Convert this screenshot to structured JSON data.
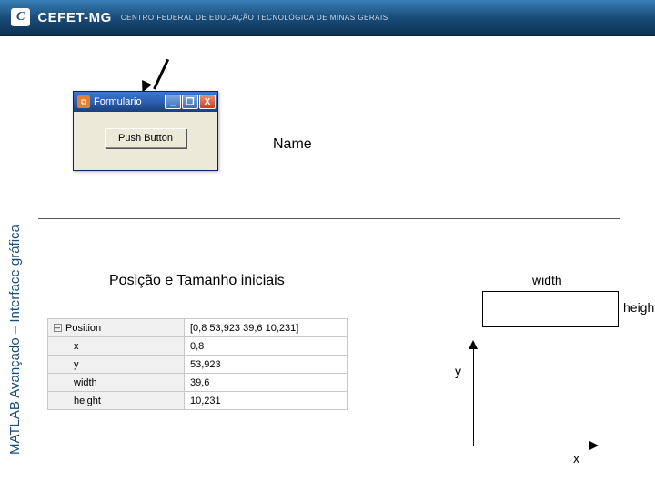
{
  "header": {
    "logo": "C",
    "brand": "CEFET-MG",
    "sub": "CENTRO FEDERAL DE EDUCAÇÃO TECNOLÓGICA DE MINAS GERAIS"
  },
  "sidebar": {
    "label": "MATLAB  Avançado – Interface gráfica"
  },
  "form": {
    "title": "Formulario",
    "button_label": "Push Button",
    "minimize": "_",
    "maximize": "❐",
    "close": "X"
  },
  "annotations": {
    "name": "Name",
    "section_title": "Posição e Tamanho iniciais",
    "width": "width",
    "height": "height",
    "x": "x",
    "y": "y"
  },
  "properties": {
    "toggle": "–",
    "root_key": "Position",
    "root_val": "[0,8 53,923 39,6 10,231]",
    "rows": [
      {
        "key": "x",
        "val": "0,8"
      },
      {
        "key": "y",
        "val": "53,923"
      },
      {
        "key": "width",
        "val": "39,6"
      },
      {
        "key": "height",
        "val": "10,231"
      }
    ]
  }
}
